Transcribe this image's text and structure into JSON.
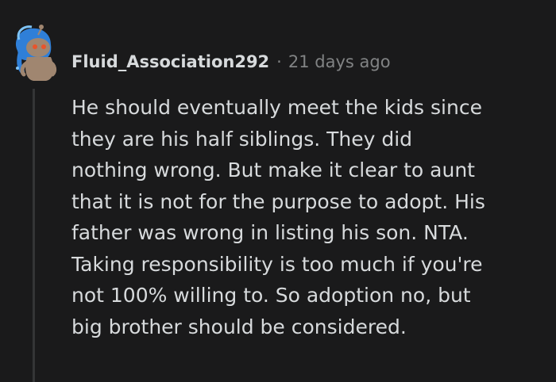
{
  "comment": {
    "username": "Fluid_Association292",
    "separator": "·",
    "timestamp": "21 days ago",
    "body": "He should eventually meet the kids since\nthey are his half siblings. They did\nnothing wrong. But make it clear to aunt\nthat it is not for the purpose to adopt. His\nfather was wrong in listing his son. NTA.\nTaking responsibility is too much if you're\nnot 100% willing to. So adoption no, but\nbig brother should be considered."
  },
  "colors": {
    "background": "#1a1a1b",
    "text": "#d7dadc",
    "meta": "#818384",
    "thread_line": "#343536",
    "avatar_hair": "#2f7fd8",
    "avatar_body": "#a08670"
  },
  "icons": {
    "avatar": "user-avatar-icon"
  }
}
